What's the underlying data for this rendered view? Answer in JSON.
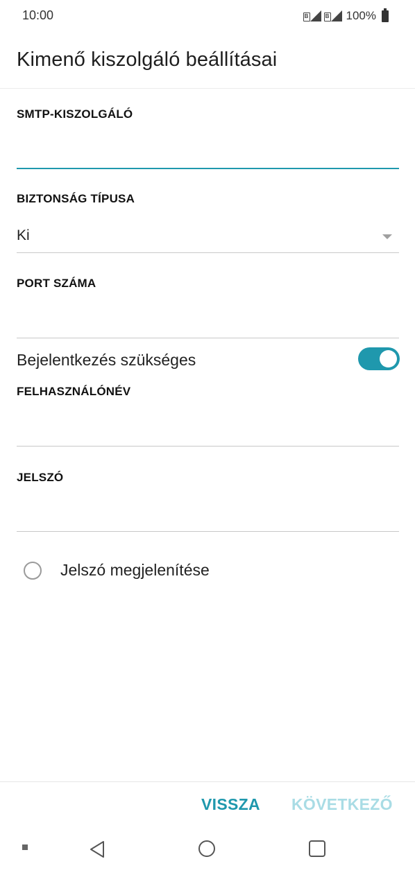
{
  "status_bar": {
    "time": "10:00",
    "battery": "100%"
  },
  "page": {
    "title": "Kimenő kiszolgáló beállításai"
  },
  "form": {
    "smtp_label": "SMTP-KISZOLGÁLÓ",
    "smtp_value": "",
    "security_label": "BIZTONSÁG TÍPUSA",
    "security_value": "Ki",
    "port_label": "PORT SZÁMA",
    "port_value": "",
    "login_required_label": "Bejelentkezés szükséges",
    "login_required_on": true,
    "username_label": "FELHASZNÁLÓNÉV",
    "username_value": "",
    "password_label": "JELSZÓ",
    "password_value": "",
    "show_password_label": "Jelszó megjelenítése",
    "show_password_checked": false
  },
  "actions": {
    "back_label": "VISSZA",
    "next_label": "KÖVETKEZŐ"
  },
  "colors": {
    "accent": "#1f98ad",
    "accent_disabled": "#a9dce5"
  },
  "icons": {
    "nav_back": "triangle-back-icon",
    "nav_home": "circle-home-icon",
    "nav_recent": "square-recent-icon"
  }
}
